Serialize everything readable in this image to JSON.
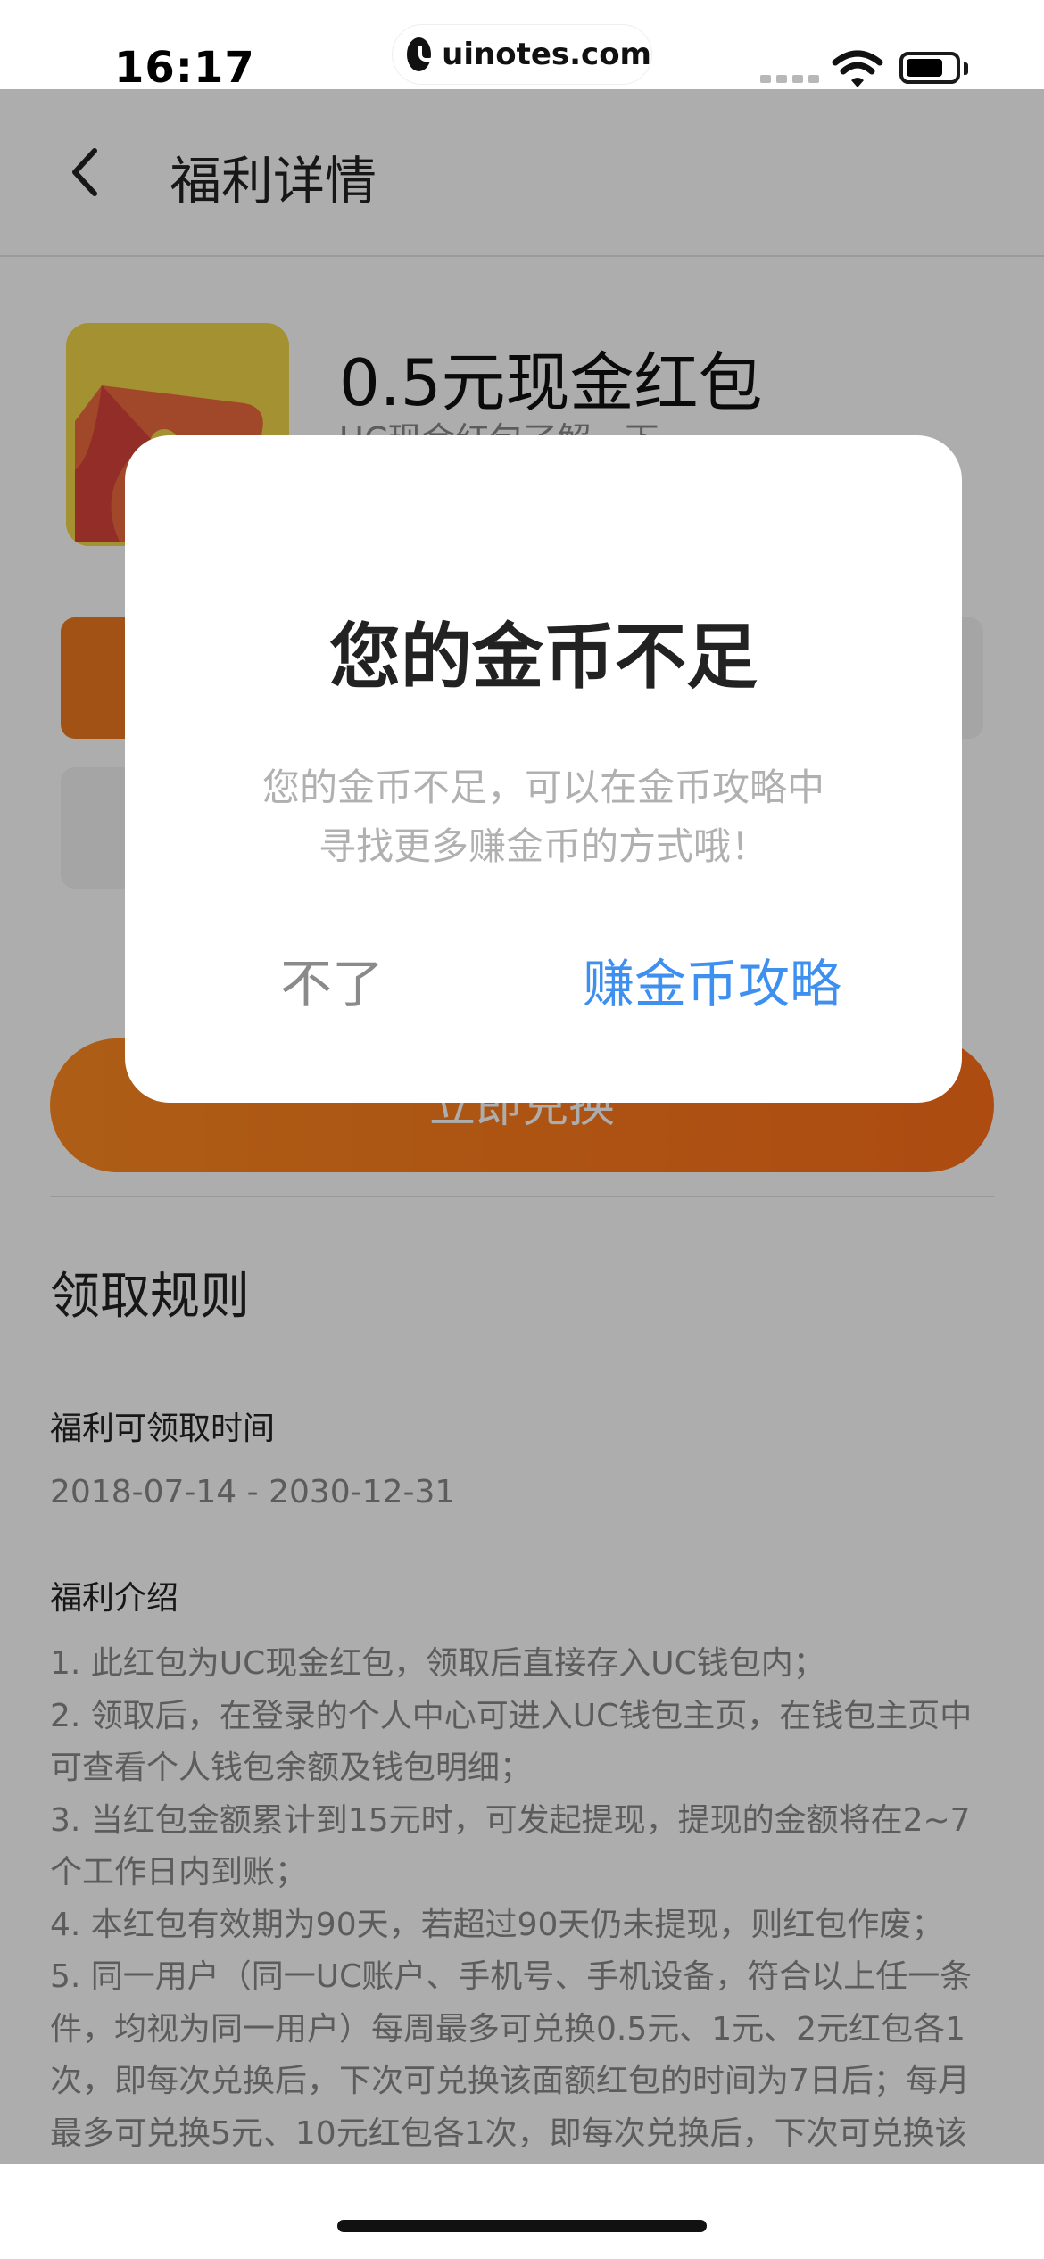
{
  "status_bar": {
    "time": "16:17",
    "url": "uinotes.com"
  },
  "nav": {
    "title": "福利详情"
  },
  "product": {
    "title": "0.5元现金红包",
    "subtitle": "UC现金红包了解一下"
  },
  "exchange": {
    "label": "立即兑换"
  },
  "rules": {
    "heading": "领取规则",
    "time_label": "福利可领取时间",
    "time_value": "2018-07-14 - 2030-12-31",
    "intro_label": "福利介绍",
    "lines": [
      "1. 此红包为UC现金红包，领取后直接存入UC钱包内；",
      "2. 领取后，在登录的个人中心可进入UC钱包主页，在钱包主页中",
      "可查看个人钱包余额及钱包明细；",
      "3. 当红包金额累计到15元时，可发起提现，提现的金额将在2~7",
      "个工作日内到账；",
      "4. 本红包有效期为90天，若超过90天仍未提现，则红包作废；",
      "5. 同一用户（同一UC账户、手机号、手机设备，符合以上任一条",
      "件，均视为同一用户）每周最多可兑换0.5元、1元、2元红包各1",
      "次，即每次兑换后，下次可兑换该面额红包的时间为7日后；每月",
      "最多可兑换5元、10元红包各1次，即每次兑换后，下次可兑换该"
    ]
  },
  "modal": {
    "title": "您的金币不足",
    "message_line1": "您的金币不足，可以在金币攻略中",
    "message_line2": "寻找更多赚金币的方式哦！",
    "cancel_label": "不了",
    "confirm_label": "赚金币攻略"
  },
  "colors": {
    "accent_orange": "#ff7a1c",
    "link_blue": "#3d8ff0"
  }
}
